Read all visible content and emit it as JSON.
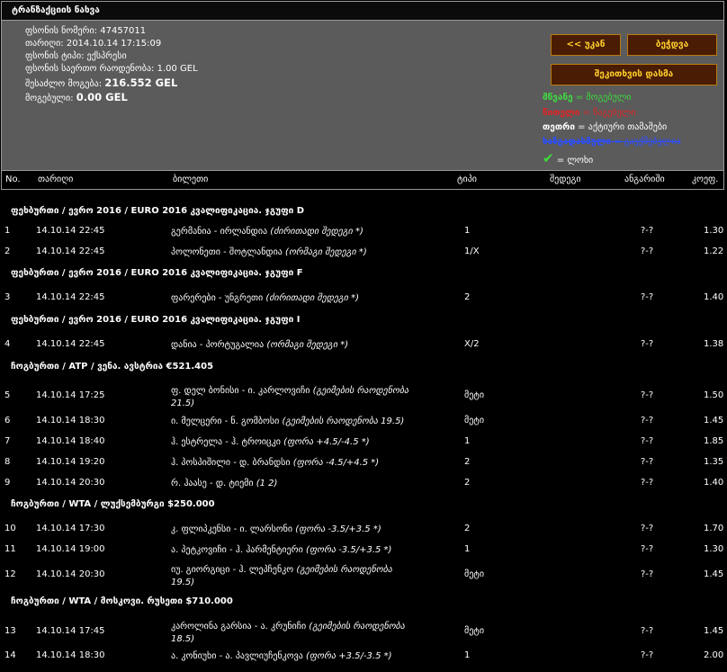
{
  "title": "ტრანზაქციის ნახვა",
  "info": [
    {
      "label": "ფსონის ნომერი:",
      "value": "47457011"
    },
    {
      "label": "თარიღი:",
      "value": "2014.10.14 17:15:09"
    },
    {
      "label": "ფსონის ტიპი:",
      "value": "ექსპრესი"
    },
    {
      "label": "ფსონის საერთო რაოდენობა:",
      "value": "1.00 GEL"
    },
    {
      "label": "შესაძლო მოგება:",
      "value": "216.552 GEL"
    },
    {
      "label": "მოგებული:",
      "value": "0.00 GEL"
    }
  ],
  "buttons": {
    "back": "<< უკან",
    "print": "ბეჭდვა",
    "copy": "შეკითხვის დასმა"
  },
  "legend": [
    {
      "key": "მწვანე",
      "sep": " = ",
      "desc": "მოგებული",
      "color": "#3ddc3d"
    },
    {
      "key": "წითელი",
      "sep": " = ",
      "desc": "წაგებული",
      "color": "#e02424"
    },
    {
      "key": "თეთრი",
      "sep": " = ",
      "desc": "აქტიური თამაშები",
      "color": "#ffffff"
    },
    {
      "key": "ხაზგადასმული",
      "sep": " = ",
      "desc": "გაუქმებულია",
      "color": "#2b4dff"
    },
    {
      "key": "✔",
      "sep": " = ",
      "desc": "ლოხი",
      "color": "#3ddc3d"
    }
  ],
  "columns": {
    "no": "No.",
    "date": "თარიღი",
    "ticket": "ბილეთი",
    "type": "ტიპი",
    "result": "შედეგი",
    "score": "ანგარიში",
    "odds": "კოეფ."
  },
  "groups": [
    {
      "title": "ფეხბურთი / ევრო 2016 / EURO 2016 კვალიფიკაცია. ჯგუფი D",
      "rows": [
        {
          "no": "1",
          "date": "14.10.14 22:45",
          "event": "გერმანია - ირლანდია ",
          "market": "(ძირითადი შედეგი *)",
          "type": "1",
          "score": "?-?",
          "odds": "1.30"
        },
        {
          "no": "2",
          "date": "14.10.14 22:45",
          "event": "პოლონეთი - შოტლანდია ",
          "market": "(ორმაგი შედეგი *)",
          "type": "1/X",
          "score": "?-?",
          "odds": "1.22"
        }
      ]
    },
    {
      "title": "ფეხბურთი / ევრო 2016 / EURO 2016 კვალიფიკაცია. ჯგუფი F",
      "rows": [
        {
          "no": "3",
          "date": "14.10.14 22:45",
          "event": "ფარერები - უნგრეთი ",
          "market": "(ძირითადი შედეგი *)",
          "type": "2",
          "score": "?-?",
          "odds": "1.40"
        }
      ]
    },
    {
      "title": "ფეხბურთი / ევრო 2016 / EURO 2016 კვალიფიკაცია. ჯგუფი I",
      "rows": [
        {
          "no": "4",
          "date": "14.10.14 22:45",
          "event": "დანია - პორტუგალია ",
          "market": "(ორმაგი შედეგი *)",
          "type": "X/2",
          "score": "?-?",
          "odds": "1.38"
        }
      ]
    },
    {
      "title": "ჩოგბურთი / ATP / ვენა. ავსტრია €521.405",
      "rows": [
        {
          "no": "5",
          "date": "14.10.14 17:25",
          "event": "ფ. დელ ბონისი - ი. კარლოვიჩი ",
          "market": "(გეიმების რაოდენობა 21.5)",
          "type": "მეტი",
          "score": "?-?",
          "odds": "1.50"
        },
        {
          "no": "6",
          "date": "14.10.14 18:30",
          "event": "ი. მელცერი - ნ. გომბოსი ",
          "market": "(გეიმების რაოდენობა 19.5)",
          "type": "მეტი",
          "score": "?-?",
          "odds": "1.45"
        },
        {
          "no": "7",
          "date": "14.10.14 18:40",
          "event": "ჰ. ესტრელა - ჰ. ტროიცკი ",
          "market": "(ფორა +4.5/-4.5 *)",
          "type": "1",
          "score": "?-?",
          "odds": "1.85"
        },
        {
          "no": "8",
          "date": "14.10.14 19:20",
          "event": "ჰ. პოსპიშილი - დ. ბრანდსი ",
          "market": "(ფორა -4.5/+4.5 *)",
          "type": "2",
          "score": "?-?",
          "odds": "1.35"
        },
        {
          "no": "9",
          "date": "14.10.14 20:30",
          "event": "რ. ჰაასე - დ. ტიემი ",
          "market": "(1 2)",
          "type": "2",
          "score": "?-?",
          "odds": "1.40"
        }
      ]
    },
    {
      "title": "ჩოგბურთი / WTA / ლუქსემბურგი $250.000",
      "rows": [
        {
          "no": "10",
          "date": "14.10.14 17:30",
          "event": "კ. ფლიპკენსი - ი. ლარსონი ",
          "market": "(ფორა -3.5/+3.5 *)",
          "type": "2",
          "score": "?-?",
          "odds": "1.70"
        },
        {
          "no": "11",
          "date": "14.10.14 19:00",
          "event": "ა. პეტკოვიჩი - ჰ. ჰარმენტიერი ",
          "market": "(ფორა -3.5/+3.5 *)",
          "type": "1",
          "score": "?-?",
          "odds": "1.30"
        },
        {
          "no": "12",
          "date": "14.10.14 20:30",
          "event": "იუ. გიორგიცი - ჰ. ლეპჩენკო ",
          "market": "(გეიმების რაოდენობა 19.5)",
          "type": "მეტი",
          "score": "?-?",
          "odds": "1.45"
        }
      ]
    },
    {
      "title": "ჩოგბურთი / WTA / მოსკოვი. რუსეთი $710.000",
      "rows": [
        {
          "no": "13",
          "date": "14.10.14 17:45",
          "event": "კაროლინა გარსია - ა. კრუნიჩი ",
          "market": "(გეიმების რაოდენობა 18.5)",
          "type": "მეტი",
          "score": "?-?",
          "odds": "1.45"
        },
        {
          "no": "14",
          "date": "14.10.14 18:30",
          "event": "ა. კონიუხი - ა. პავლიუჩენკოვა ",
          "market": "(ფორა +3.5/-3.5 *)",
          "type": "1",
          "score": "?-?",
          "odds": "2.00"
        }
      ]
    }
  ]
}
